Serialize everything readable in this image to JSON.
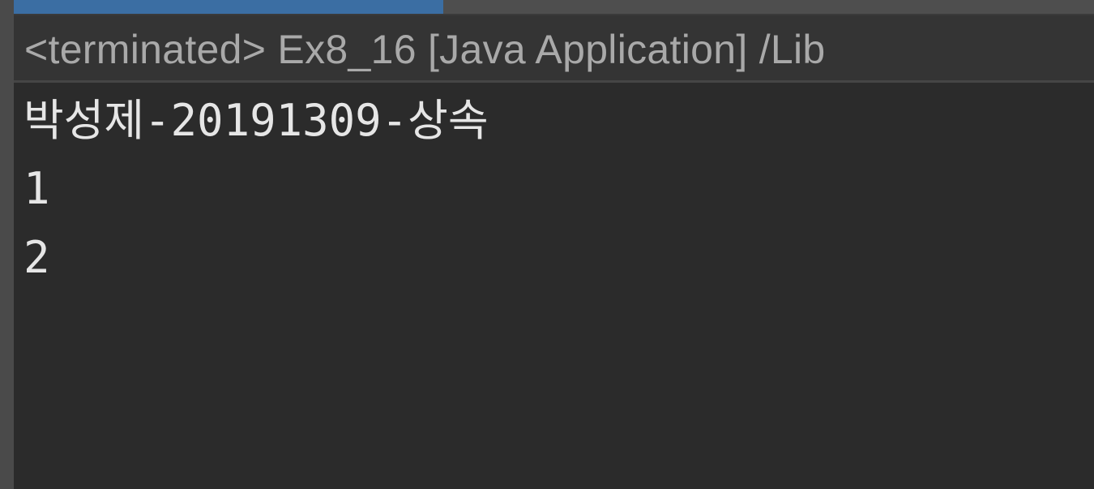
{
  "console": {
    "status_text": "<terminated> Ex8_16 [Java Application] /Lib",
    "output_lines": [
      "박성제-20191309-상속",
      "1",
      "2"
    ]
  },
  "colors": {
    "background": "#2b2b2b",
    "status_bar": "#343434",
    "active_tab": "#3b6ea3",
    "status_text": "#a9a9a9",
    "output_text": "#e6e6e6"
  }
}
